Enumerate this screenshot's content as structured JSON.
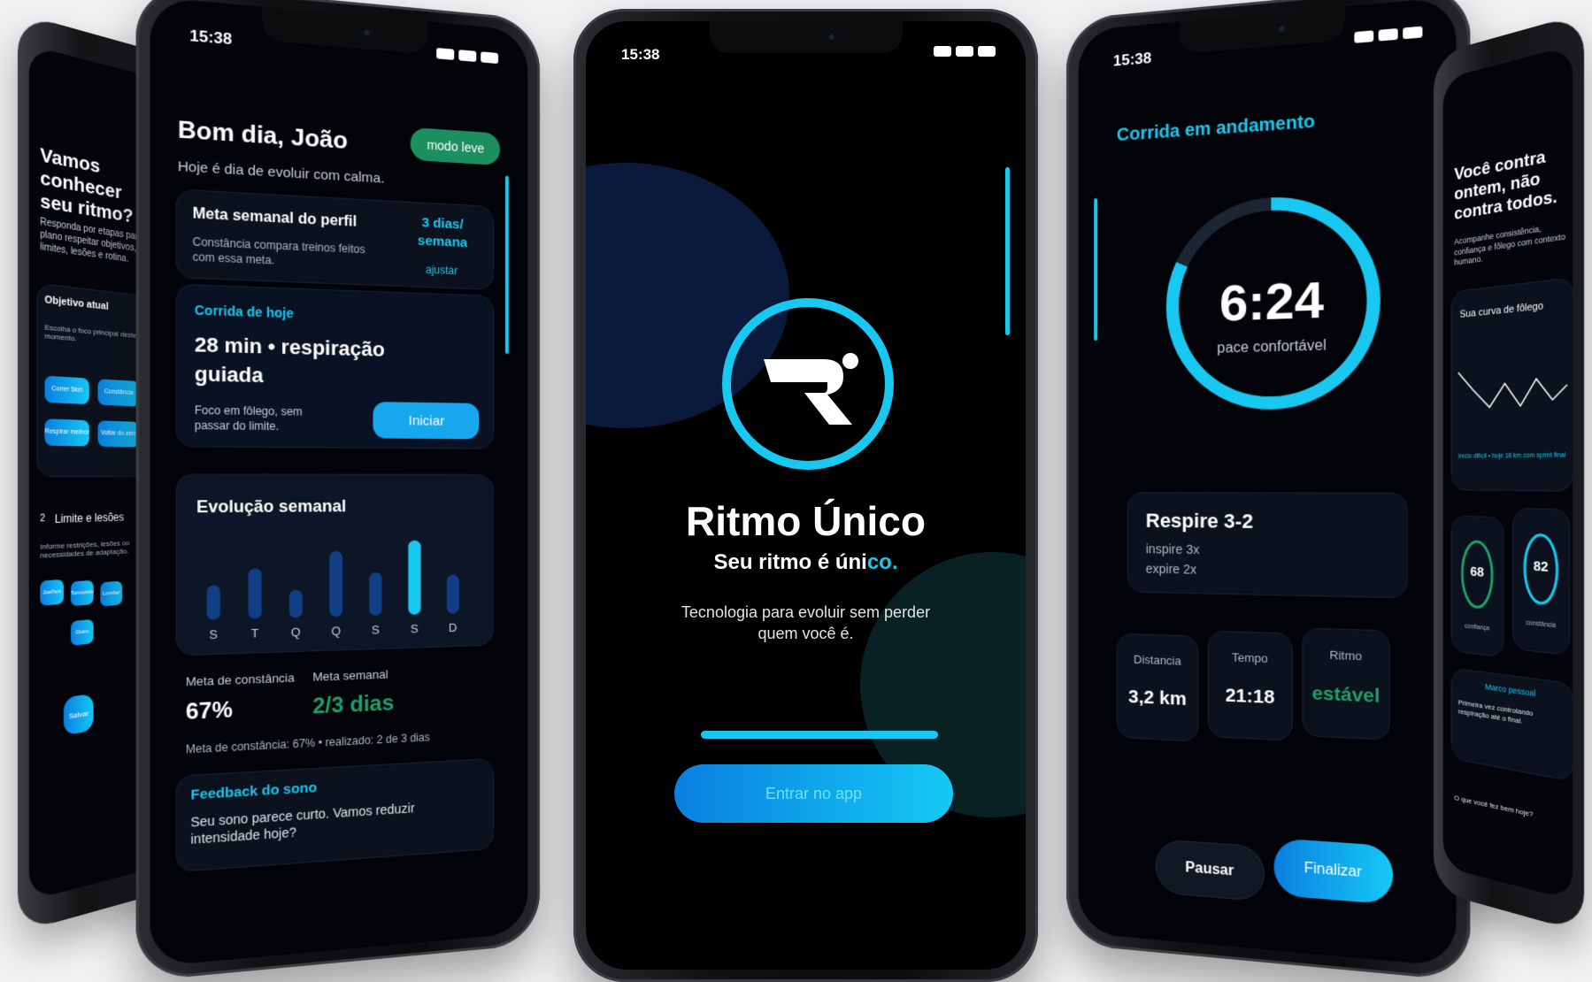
{
  "status_time": "15:38",
  "left_far": {
    "title": "Vamos conhecer seu ritmo?",
    "subtitle": "Responda por etapas para o plano respeitar objetivos, limites, lesões e rotina.",
    "section1": "Objetivo atual",
    "section1_hint": "Escolha o foco principal deste momento.",
    "chips1": [
      "Correr 5km",
      "Constância",
      "Respirar melhor",
      "Voltar do zero"
    ],
    "section2_num": "2",
    "section2": "Limite e lesões",
    "section2_hint": "Informe restrições, lesões ou necessidades de adaptação.",
    "chips2": [
      "Joelhos",
      "Tornozelo",
      "Lombar",
      "Outro"
    ],
    "button": "Salvar"
  },
  "dashboard": {
    "greeting": "Bom dia, João",
    "subgreeting": "Hoje é dia de evoluir com calma.",
    "mode_badge": "modo leve",
    "goal_title": "Meta semanal do perfil",
    "goal_desc": "Constância compara treinos feitos com essa meta.",
    "goal_value": "3 dias/ semana",
    "goal_adjust": "ajustar",
    "run_label": "Corrida de hoje",
    "run_title": "28 min • respiração guiada",
    "run_desc": "Foco em fôlego, sem passar do limite.",
    "run_button": "Iniciar",
    "weekly_title": "Evolução semanal",
    "stat1_label": "Meta de constância",
    "stat1_value": "67%",
    "stat2_label": "Meta semanal",
    "stat2_value": "2/3 dias",
    "stat_note": "Meta de constância: 67% • realizado: 2 de 3 dias",
    "feedback_title": "Feedback do sono",
    "feedback_text": "Seu sono parece curto. Vamos reduzir intensidade hoje?"
  },
  "chart_data": {
    "type": "bar",
    "title": "Evolução semanal",
    "categories": [
      "S",
      "T",
      "Q",
      "Q",
      "S",
      "S",
      "D"
    ],
    "values": [
      34,
      50,
      28,
      66,
      44,
      76,
      40
    ],
    "highlight_index": 5,
    "colors": {
      "bar": "#123e86",
      "highlight": "#19c8f0"
    }
  },
  "splash": {
    "app_name": "Ritmo Único",
    "tagline_a": "Seu ritmo é úni",
    "tagline_b": "co.",
    "desc": "Tecnologia para evoluir sem perder quem você é.",
    "enter_button": "Entrar no app",
    "progress": 1.0
  },
  "running": {
    "title": "Corrida em andamento",
    "pace": "6:24",
    "pace_label": "pace confortável",
    "ring_progress": 0.82,
    "breath_title": "Respire 3-2",
    "breath_in": "inspire 3x",
    "breath_out": "expire 2x",
    "metrics": [
      {
        "label": "Distancia",
        "value": "3,2 km"
      },
      {
        "label": "Tempo",
        "value": "21:18"
      },
      {
        "label": "Ritmo",
        "value": "estável"
      }
    ],
    "pause_button": "Pausar",
    "finish_button": "Finalizar"
  },
  "right_far": {
    "title": "Você contra ontem, não contra todos.",
    "subtitle": "Acompanhe consistência, confiança e fôlego com contexto humano.",
    "curve_title": "Sua curva de fôlego",
    "curve_note": "Início difícil • hoje 18 km com sprint final",
    "score1_value": "68",
    "score1_label": "confiança",
    "score2_value": "82",
    "score2_label": "constância",
    "milestone_title": "Marco pessoal",
    "milestone_text": "Primeira vez controlando respiração até o final.",
    "bottom_text": "O que você fez bem hoje?"
  },
  "colors": {
    "accent": "#19c8f0",
    "green": "#1fa06a",
    "navy": "#0a1a3c"
  }
}
